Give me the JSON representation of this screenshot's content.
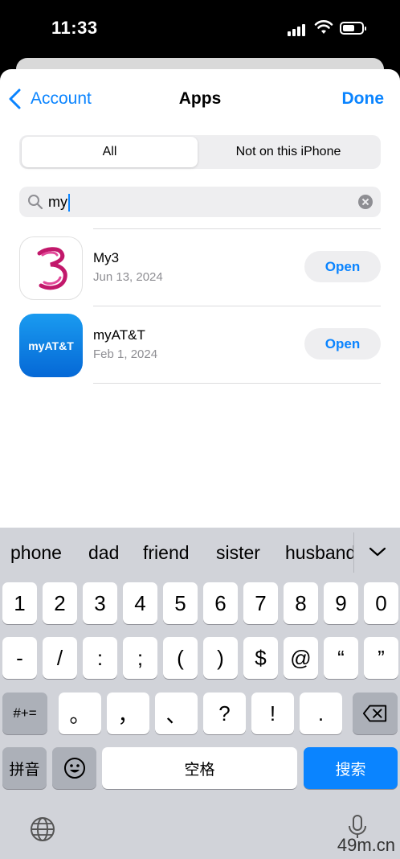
{
  "status_bar": {
    "time": "11:33"
  },
  "nav": {
    "back_label": "Account",
    "title": "Apps",
    "done_label": "Done"
  },
  "segment": {
    "all_label": "All",
    "not_on_label": "Not on this iPhone"
  },
  "search": {
    "value": "my"
  },
  "apps": [
    {
      "name": "My3",
      "date": "Jun 13, 2024",
      "action": "Open",
      "icon": "three-logo-icon"
    },
    {
      "name": "myAT&T",
      "date": "Feb 1, 2024",
      "action": "Open",
      "icon": "myatt-icon",
      "icon_text": "myAT&T"
    }
  ],
  "keyboard": {
    "suggestions": [
      "phone",
      "dad",
      "friend",
      "sister",
      "husband"
    ],
    "row1": [
      "1",
      "2",
      "3",
      "4",
      "5",
      "6",
      "7",
      "8",
      "9",
      "0"
    ],
    "row2": [
      "-",
      "/",
      ":",
      ";",
      "(",
      ")",
      "$",
      "@",
      "“",
      "”"
    ],
    "row3": {
      "shift": "#+=",
      "keys": [
        "。",
        "，",
        "、",
        "?",
        "!",
        "."
      ]
    },
    "row4": {
      "lang": "拼音",
      "space": "空格",
      "search": "搜索"
    }
  },
  "watermark": "49m.cn",
  "colors": {
    "accent": "#0a84ff",
    "keyboard_bg": "#d1d3d9"
  }
}
